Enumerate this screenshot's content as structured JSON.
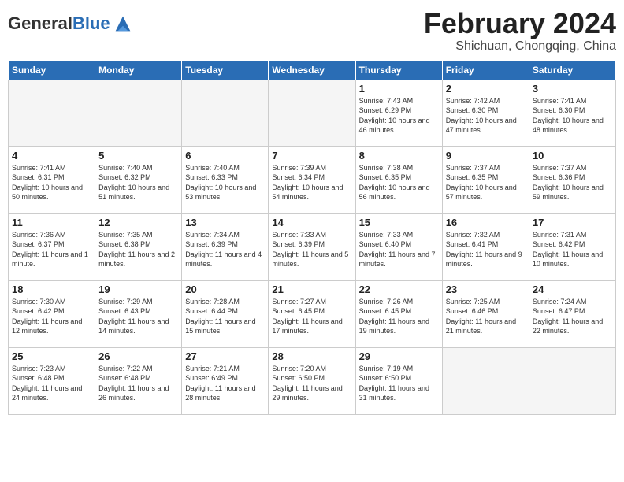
{
  "header": {
    "logo_general": "General",
    "logo_blue": "Blue",
    "title": "February 2024",
    "location": "Shichuan, Chongqing, China"
  },
  "days_of_week": [
    "Sunday",
    "Monday",
    "Tuesday",
    "Wednesday",
    "Thursday",
    "Friday",
    "Saturday"
  ],
  "weeks": [
    [
      {
        "day": "",
        "empty": true
      },
      {
        "day": "",
        "empty": true
      },
      {
        "day": "",
        "empty": true
      },
      {
        "day": "",
        "empty": true
      },
      {
        "day": "1",
        "sunrise": "7:43 AM",
        "sunset": "6:29 PM",
        "daylight": "Daylight: 10 hours and 46 minutes."
      },
      {
        "day": "2",
        "sunrise": "7:42 AM",
        "sunset": "6:30 PM",
        "daylight": "Daylight: 10 hours and 47 minutes."
      },
      {
        "day": "3",
        "sunrise": "7:41 AM",
        "sunset": "6:30 PM",
        "daylight": "Daylight: 10 hours and 48 minutes."
      }
    ],
    [
      {
        "day": "4",
        "sunrise": "7:41 AM",
        "sunset": "6:31 PM",
        "daylight": "Daylight: 10 hours and 50 minutes."
      },
      {
        "day": "5",
        "sunrise": "7:40 AM",
        "sunset": "6:32 PM",
        "daylight": "Daylight: 10 hours and 51 minutes."
      },
      {
        "day": "6",
        "sunrise": "7:40 AM",
        "sunset": "6:33 PM",
        "daylight": "Daylight: 10 hours and 53 minutes."
      },
      {
        "day": "7",
        "sunrise": "7:39 AM",
        "sunset": "6:34 PM",
        "daylight": "Daylight: 10 hours and 54 minutes."
      },
      {
        "day": "8",
        "sunrise": "7:38 AM",
        "sunset": "6:35 PM",
        "daylight": "Daylight: 10 hours and 56 minutes."
      },
      {
        "day": "9",
        "sunrise": "7:37 AM",
        "sunset": "6:35 PM",
        "daylight": "Daylight: 10 hours and 57 minutes."
      },
      {
        "day": "10",
        "sunrise": "7:37 AM",
        "sunset": "6:36 PM",
        "daylight": "Daylight: 10 hours and 59 minutes."
      }
    ],
    [
      {
        "day": "11",
        "sunrise": "7:36 AM",
        "sunset": "6:37 PM",
        "daylight": "Daylight: 11 hours and 1 minute."
      },
      {
        "day": "12",
        "sunrise": "7:35 AM",
        "sunset": "6:38 PM",
        "daylight": "Daylight: 11 hours and 2 minutes."
      },
      {
        "day": "13",
        "sunrise": "7:34 AM",
        "sunset": "6:39 PM",
        "daylight": "Daylight: 11 hours and 4 minutes."
      },
      {
        "day": "14",
        "sunrise": "7:33 AM",
        "sunset": "6:39 PM",
        "daylight": "Daylight: 11 hours and 5 minutes."
      },
      {
        "day": "15",
        "sunrise": "7:33 AM",
        "sunset": "6:40 PM",
        "daylight": "Daylight: 11 hours and 7 minutes."
      },
      {
        "day": "16",
        "sunrise": "7:32 AM",
        "sunset": "6:41 PM",
        "daylight": "Daylight: 11 hours and 9 minutes."
      },
      {
        "day": "17",
        "sunrise": "7:31 AM",
        "sunset": "6:42 PM",
        "daylight": "Daylight: 11 hours and 10 minutes."
      }
    ],
    [
      {
        "day": "18",
        "sunrise": "7:30 AM",
        "sunset": "6:42 PM",
        "daylight": "Daylight: 11 hours and 12 minutes."
      },
      {
        "day": "19",
        "sunrise": "7:29 AM",
        "sunset": "6:43 PM",
        "daylight": "Daylight: 11 hours and 14 minutes."
      },
      {
        "day": "20",
        "sunrise": "7:28 AM",
        "sunset": "6:44 PM",
        "daylight": "Daylight: 11 hours and 15 minutes."
      },
      {
        "day": "21",
        "sunrise": "7:27 AM",
        "sunset": "6:45 PM",
        "daylight": "Daylight: 11 hours and 17 minutes."
      },
      {
        "day": "22",
        "sunrise": "7:26 AM",
        "sunset": "6:45 PM",
        "daylight": "Daylight: 11 hours and 19 minutes."
      },
      {
        "day": "23",
        "sunrise": "7:25 AM",
        "sunset": "6:46 PM",
        "daylight": "Daylight: 11 hours and 21 minutes."
      },
      {
        "day": "24",
        "sunrise": "7:24 AM",
        "sunset": "6:47 PM",
        "daylight": "Daylight: 11 hours and 22 minutes."
      }
    ],
    [
      {
        "day": "25",
        "sunrise": "7:23 AM",
        "sunset": "6:48 PM",
        "daylight": "Daylight: 11 hours and 24 minutes."
      },
      {
        "day": "26",
        "sunrise": "7:22 AM",
        "sunset": "6:48 PM",
        "daylight": "Daylight: 11 hours and 26 minutes."
      },
      {
        "day": "27",
        "sunrise": "7:21 AM",
        "sunset": "6:49 PM",
        "daylight": "Daylight: 11 hours and 28 minutes."
      },
      {
        "day": "28",
        "sunrise": "7:20 AM",
        "sunset": "6:50 PM",
        "daylight": "Daylight: 11 hours and 29 minutes."
      },
      {
        "day": "29",
        "sunrise": "7:19 AM",
        "sunset": "6:50 PM",
        "daylight": "Daylight: 11 hours and 31 minutes."
      },
      {
        "day": "",
        "empty": true
      },
      {
        "day": "",
        "empty": true
      }
    ]
  ]
}
